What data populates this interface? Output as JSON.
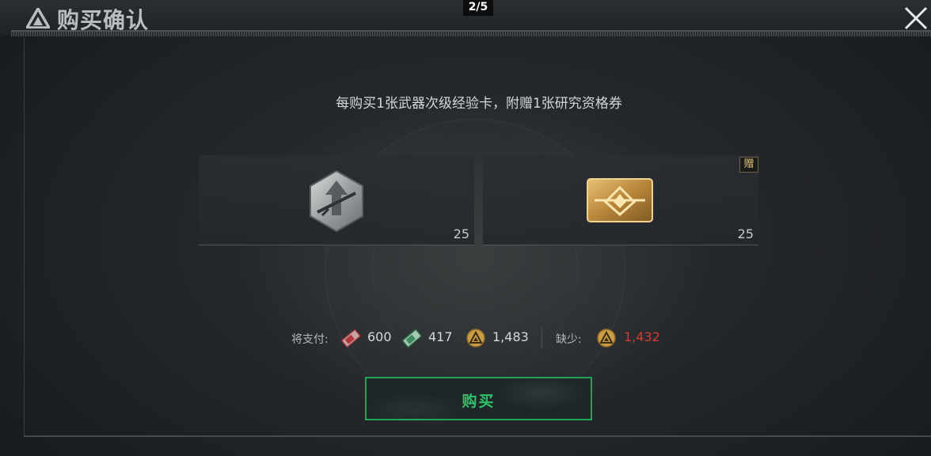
{
  "header": {
    "title": "购买确认",
    "page_indicator": "2/5",
    "logo_icon": "triangle-logo-icon",
    "close_icon": "close-icon"
  },
  "dialog": {
    "headline": "每购买1张武器次级经验卡，附赠1张研究资格券",
    "items": [
      {
        "icon": "weapon-xp-card-icon",
        "quantity": "25"
      },
      {
        "icon": "research-voucher-icon",
        "quantity": "25",
        "badge": "赠"
      }
    ],
    "payment": {
      "label": "将支付:",
      "costs": [
        {
          "icon": "red-ticket-icon",
          "value": "600"
        },
        {
          "icon": "green-ticket-icon",
          "value": "417"
        },
        {
          "icon": "gold-coin-icon",
          "value": "1,483"
        }
      ],
      "shortage_label": "缺少:",
      "shortage": {
        "icon": "gold-coin-icon",
        "value": "1,432"
      }
    },
    "buy_button": "购买"
  },
  "colors": {
    "accent_green": "#2fc26a",
    "shortage_red": "#d23a35",
    "gold": "#d4a94e"
  }
}
